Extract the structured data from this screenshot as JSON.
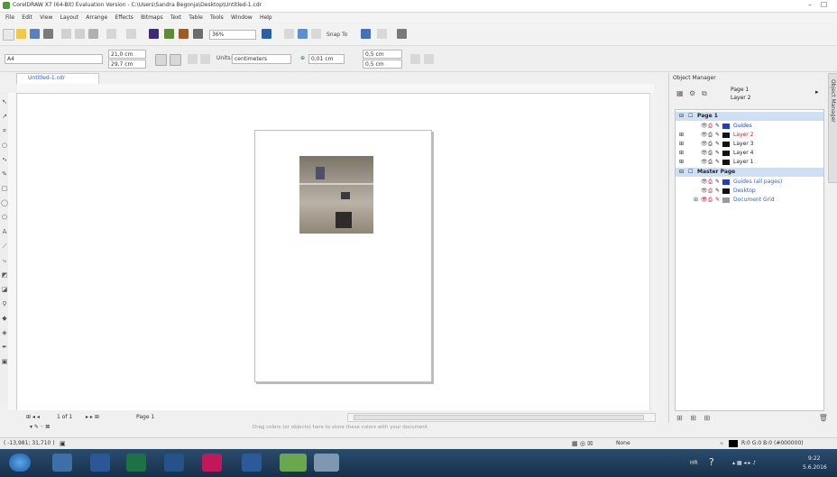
{
  "window": {
    "title": "CorelDRAW X7 (64-Bit) Evaluation Version - C:\\Users\\Sandra Begonja\\Desktop\\Untitled-1.cdr",
    "controls": [
      "–",
      "☐"
    ]
  },
  "menu": [
    "File",
    "Edit",
    "View",
    "Layout",
    "Arrange",
    "Effects",
    "Bitmaps",
    "Text",
    "Table",
    "Tools",
    "Window",
    "Help"
  ],
  "toolbar": {
    "zoom": "36%",
    "snap_to": "Snap To"
  },
  "property_bar": {
    "paper": "A4",
    "width": "21,0 cm",
    "height": "29,7 cm",
    "units_label": "Units:",
    "units": "centimeters",
    "nudge": "0,01 cm",
    "dup_x": "0,5 cm",
    "dup_y": "0,5 cm"
  },
  "document_tab": "Untitled-1.cdr",
  "page_nav": {
    "counter": "1 of 1",
    "page_tab": "Page 1"
  },
  "canvas_hint": "Drag colors (or objects) here to store these colors with your document",
  "object_manager": {
    "title": "Object Manager",
    "current_page": "Page 1",
    "current_layer": "Layer 2",
    "items": [
      {
        "label": "Page 1",
        "kind": "page",
        "selected": true
      },
      {
        "label": "Guides",
        "kind": "layer",
        "color": "#1f3bd6",
        "text_color": "#1f3bd6"
      },
      {
        "label": "Layer 2",
        "kind": "layer",
        "color": "#111111",
        "text_color": "#d22020"
      },
      {
        "label": "Layer 3",
        "kind": "layer",
        "color": "#111111",
        "text_color": "#333333"
      },
      {
        "label": "Layer 4",
        "kind": "layer",
        "color": "#111111",
        "text_color": "#333333"
      },
      {
        "label": "Layer 1",
        "kind": "layer",
        "color": "#111111",
        "text_color": "#333333"
      },
      {
        "label": "Master Page",
        "kind": "page",
        "selected": true
      },
      {
        "label": "Guides (all pages)",
        "kind": "layer",
        "color": "#1f3bd6",
        "text_color": "#3a5fc8"
      },
      {
        "label": "Desktop",
        "kind": "layer",
        "color": "#111111",
        "text_color": "#3a5fc8"
      },
      {
        "label": "Document Grid",
        "kind": "layer",
        "color": "#9a9a9a",
        "text_color": "#3a5fc8"
      }
    ]
  },
  "side_tab": "Object Manager",
  "status": {
    "coords": "( -13,981; 31,710 )",
    "fill": "None",
    "outline": "R:0 G:0 B:0 (#000000)"
  },
  "taskbar": {
    "time": "9:22",
    "date": "5.6.2016"
  }
}
